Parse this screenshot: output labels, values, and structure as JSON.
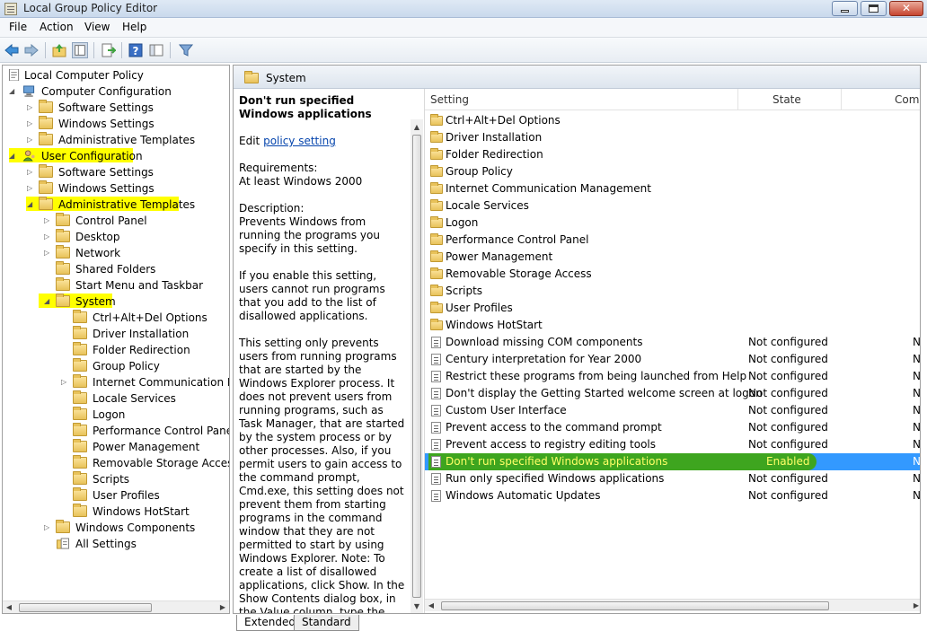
{
  "window": {
    "title": "Local Group Policy Editor"
  },
  "menu": [
    "File",
    "Action",
    "View",
    "Help"
  ],
  "tree": [
    {
      "label": "Local Computer Policy"
    },
    {
      "label": "Computer Configuration"
    },
    {
      "label": "Software Settings"
    },
    {
      "label": "Windows Settings"
    },
    {
      "label": "Administrative Templates"
    },
    {
      "label": "User Configuration"
    },
    {
      "label": "Software Settings"
    },
    {
      "label": "Windows Settings"
    },
    {
      "label": "Administrative Templates"
    },
    {
      "label": "Control Panel"
    },
    {
      "label": "Desktop"
    },
    {
      "label": "Network"
    },
    {
      "label": "Shared Folders"
    },
    {
      "label": "Start Menu and Taskbar"
    },
    {
      "label": "System"
    },
    {
      "label": "Ctrl+Alt+Del Options"
    },
    {
      "label": "Driver Installation"
    },
    {
      "label": "Folder Redirection"
    },
    {
      "label": "Group Policy"
    },
    {
      "label": "Internet Communication Ma"
    },
    {
      "label": "Locale Services"
    },
    {
      "label": "Logon"
    },
    {
      "label": "Performance Control Panel"
    },
    {
      "label": "Power Management"
    },
    {
      "label": "Removable Storage Access"
    },
    {
      "label": "Scripts"
    },
    {
      "label": "User Profiles"
    },
    {
      "label": "Windows HotStart"
    },
    {
      "label": "Windows Components"
    },
    {
      "label": "All Settings"
    }
  ],
  "pane": {
    "title": "System"
  },
  "description": {
    "title": "Don't run specified Windows applications",
    "edit_prefix": "Edit",
    "edit_link": "policy setting",
    "requirements_label": "Requirements:",
    "requirements": "At least Windows 2000",
    "description_label": "Description:",
    "p1": "Prevents Windows from running the programs you specify in this setting.",
    "p2": "If you enable this setting, users cannot run programs that you add to the list of disallowed applications.",
    "p3": "This setting only prevents users from running programs that are started by the Windows Explorer process. It does not prevent users from running programs, such as Task Manager, that are started by the system process or by other processes. Also, if you permit users to gain access to the command prompt, Cmd.exe, this setting does not prevent them from starting programs in the command window that they are not permitted to start by using Windows Explorer. Note: To create a list of disallowed applications, click Show. In the Show Contents dialog box, in the Value column, type the application executable name (e.g., Winword.exe,"
  },
  "list": {
    "columns": {
      "setting": "Setting",
      "state": "State",
      "comment": "Com"
    },
    "folders": [
      "Ctrl+Alt+Del Options",
      "Driver Installation",
      "Folder Redirection",
      "Group Policy",
      "Internet Communication Management",
      "Locale Services",
      "Logon",
      "Performance Control Panel",
      "Power Management",
      "Removable Storage Access",
      "Scripts",
      "User Profiles",
      "Windows HotStart"
    ],
    "settings": [
      {
        "name": "Download missing COM components",
        "state": "Not configured",
        "comment": "N"
      },
      {
        "name": "Century interpretation for Year 2000",
        "state": "Not configured",
        "comment": "N"
      },
      {
        "name": "Restrict these programs from being launched from Help",
        "state": "Not configured",
        "comment": "N"
      },
      {
        "name": "Don't display the Getting Started welcome screen at logon",
        "state": "Not configured",
        "comment": "N"
      },
      {
        "name": "Custom User Interface",
        "state": "Not configured",
        "comment": "N"
      },
      {
        "name": "Prevent access to the command prompt",
        "state": "Not configured",
        "comment": "N"
      },
      {
        "name": "Prevent access to registry editing tools",
        "state": "Not configured",
        "comment": "N"
      },
      {
        "name": "Don't run specified Windows applications",
        "state": "Enabled",
        "comment": "N"
      },
      {
        "name": "Run only specified Windows applications",
        "state": "Not configured",
        "comment": "N"
      },
      {
        "name": "Windows Automatic Updates",
        "state": "Not configured",
        "comment": "N"
      }
    ]
  },
  "tabs": [
    "Extended",
    "Standard"
  ]
}
